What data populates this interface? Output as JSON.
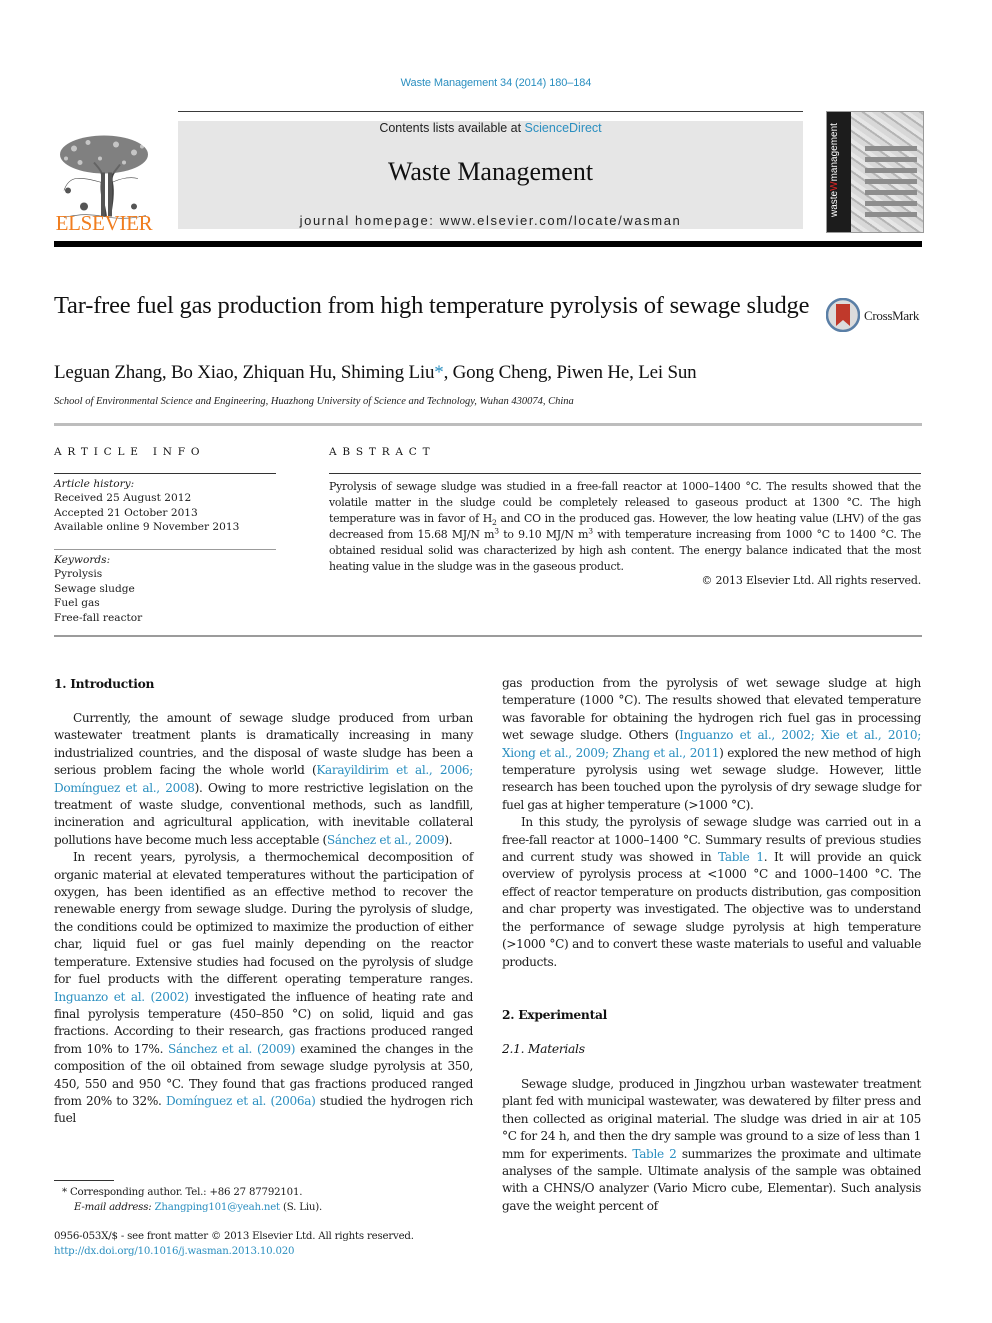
{
  "citation": "Waste Management 34 (2014) 180–184",
  "masthead": {
    "publisher_logo": "ELSEVIER",
    "contents_prefix": "Contents lists available at ",
    "contents_link": "ScienceDirect",
    "journal_title": "Waste Management",
    "homepage": "journal homepage: www.elsevier.com/locate/wasman",
    "cover_spine_a": "waste",
    "cover_spine_b": "management"
  },
  "article": {
    "title": "Tar-free fuel gas production from high temperature pyrolysis of sewage sludge",
    "crossmark_label": "CrossMark",
    "authors_before": "Leguan Zhang, Bo Xiao, Zhiquan Hu, Shiming Liu",
    "author_marker": "*",
    "authors_after": ", Gong Cheng, Piwen He, Lei Sun",
    "affiliation": "School of Environmental Science and Engineering, Huazhong University of Science and Technology, Wuhan 430074, China"
  },
  "article_info": {
    "heading": "ARTICLE INFO",
    "history_label": "Article history:",
    "history": [
      "Received 25 August 2012",
      "Accepted 21 October 2013",
      "Available online 9 November 2013"
    ],
    "keywords_label": "Keywords:",
    "keywords": [
      "Pyrolysis",
      "Sewage sludge",
      "Fuel gas",
      "Free-fall reactor"
    ]
  },
  "abstract": {
    "heading": "ABSTRACT",
    "segments": [
      {
        "t": "Pyrolysis of sewage sludge was studied in a free-fall reactor at 1000–1400 °C. The results showed that the volatile matter in the sludge could be completely released to gaseous product at 1300 °C. The high temperature was in favor of H"
      },
      {
        "t": "2",
        "sub": true
      },
      {
        "t": " and CO in the produced gas. However, the low heating value (LHV) of the gas decreased from 15.68 MJ/N m"
      },
      {
        "t": "3",
        "sup": true
      },
      {
        "t": " to 9.10 MJ/N m"
      },
      {
        "t": "3",
        "sup": true
      },
      {
        "t": " with temperature increasing from 1000 °C to 1400 °C. The obtained residual solid was characterized by high ash content. The energy balance indicated that the most heating value in the sludge was in the gaseous product."
      }
    ],
    "copyright": "© 2013 Elsevier Ltd. All rights reserved."
  },
  "sections": {
    "intro_heading": "1. Introduction",
    "experimental_heading": "2. Experimental",
    "materials_heading": "2.1. Materials"
  },
  "left_column": [
    {
      "segments": [
        {
          "t": "Currently, the amount of sewage sludge produced from urban wastewater treatment plants is dramatically increasing in many industrialized countries, and the disposal of waste sludge has been a serious problem facing the whole world ("
        },
        {
          "t": "Karayildirim et al., 2006; Domínguez et al., 2008",
          "link": true
        },
        {
          "t": "). Owing to more restrictive legislation on the treatment of waste sludge, conventional methods, such as landfill, incineration and agricultural application, with inevitable collateral pollutions have become much less acceptable ("
        },
        {
          "t": "Sánchez et al., 2009",
          "link": true
        },
        {
          "t": ")."
        }
      ]
    },
    {
      "segments": [
        {
          "t": "In recent years, pyrolysis, a thermochemical decomposition of organic material at elevated temperatures without the participation of oxygen, has been identified as an effective method to recover the renewable energy from sewage sludge. During the pyrolysis of sludge, the conditions could be optimized to maximize the production of either char, liquid fuel or gas fuel mainly depending on the reactor temperature. Extensive studies had focused on the pyrolysis of sludge for fuel products with the different operating temperature ranges. "
        },
        {
          "t": "Inguanzo et al. (2002)",
          "link": true
        },
        {
          "t": " investigated the influence of heating rate and final pyrolysis temperature (450–850 °C) on solid, liquid and gas fractions. According to their research, gas fractions produced ranged from 10% to 17%. "
        },
        {
          "t": "Sánchez et al. (2009)",
          "link": true
        },
        {
          "t": " examined the changes in the composition of the oil obtained from sewage sludge pyrolysis at 350, 450, 550 and 950 °C. They found that gas fractions produced ranged from 20% to 32%. "
        },
        {
          "t": "Domínguez et al. (2006a)",
          "link": true
        },
        {
          "t": " studied the hydrogen rich fuel"
        }
      ]
    }
  ],
  "right_column": [
    {
      "noindent": true,
      "segments": [
        {
          "t": "gas production from the pyrolysis of wet sewage sludge at high temperature (1000 °C). The results showed that elevated temperature was favorable for obtaining the hydrogen rich fuel gas in processing wet sewage sludge. Others ("
        },
        {
          "t": "Inguanzo et al., 2002; Xie et al., 2010; Xiong et al., 2009; Zhang et al., 2011",
          "link": true
        },
        {
          "t": ") explored the new method of high temperature pyrolysis using wet sewage sludge. However, little research has been touched upon the pyrolysis of dry sewage sludge for fuel gas at higher temperature (>1000 °C)."
        }
      ]
    },
    {
      "segments": [
        {
          "t": "In this study, the pyrolysis of sewage sludge was carried out in a free-fall reactor at 1000–1400 °C. Summary results of previous studies and current study was showed in "
        },
        {
          "t": "Table 1",
          "link": true
        },
        {
          "t": ". It will provide an quick overview of pyrolysis process at <1000 °C and 1000–1400 °C. The effect of reactor temperature on products distribution, gas composition and char property was investigated. The objective was to understand the performance of sewage sludge pyrolysis at high temperature (>1000 °C) and to convert these waste materials to useful and valuable products."
        }
      ]
    }
  ],
  "materials_paragraph": [
    {
      "t": "Sewage sludge, produced in Jingzhou urban wastewater treatment plant fed with municipal wastewater, was dewatered by filter press and then collected as original material. The sludge was dried in air at 105 °C for 24 h, and then the dry sample was ground to a size of less than 1 mm for experiments. "
    },
    {
      "t": "Table 2",
      "link": true
    },
    {
      "t": " summarizes the proximate and ultimate analyses of the sample. Ultimate analysis of the sample was obtained with a CHNS/O analyzer (Vario Micro cube, Elementar). Such analysis gave the weight percent of"
    }
  ],
  "footnote": {
    "marker": "*",
    "corresponding": "Corresponding author. Tel.: +86 27 87792101.",
    "email_label": "E-mail address:",
    "email": "Zhangping101@yeah.net",
    "email_suffix": " (S. Liu).",
    "issn": "0956-053X/$ - see front matter © 2013 Elsevier Ltd. All rights reserved.",
    "doi": "http://dx.doi.org/10.1016/j.wasman.2013.10.020"
  },
  "colors": {
    "link": "#2b8fc0",
    "elsevier_orange": "#f07d1f",
    "banner_gray": "#e6e6e6"
  }
}
